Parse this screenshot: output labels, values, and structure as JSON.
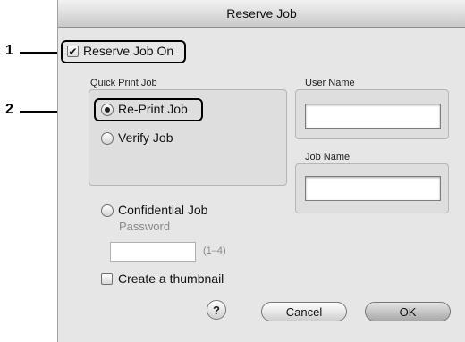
{
  "window": {
    "title": "Reserve Job"
  },
  "callouts": {
    "one": "1",
    "two": "2"
  },
  "reserve_job_on": {
    "label": "Reserve Job On",
    "checked": true,
    "checkmark": "✔"
  },
  "quick_print": {
    "group_label": "Quick Print Job",
    "reprint_label": "Re-Print Job",
    "verify_label": "Verify Job",
    "selected": "Re-Print Job"
  },
  "user_name": {
    "label": "User Name",
    "value": ""
  },
  "job_name": {
    "label": "Job Name",
    "value": ""
  },
  "confidential": {
    "label": "Confidential Job",
    "password_label": "Password",
    "password_value": "",
    "range_hint": "(1–4)"
  },
  "thumbnail": {
    "label": "Create a thumbnail",
    "checked": false
  },
  "buttons": {
    "help": "?",
    "cancel": "Cancel",
    "ok": "OK"
  }
}
